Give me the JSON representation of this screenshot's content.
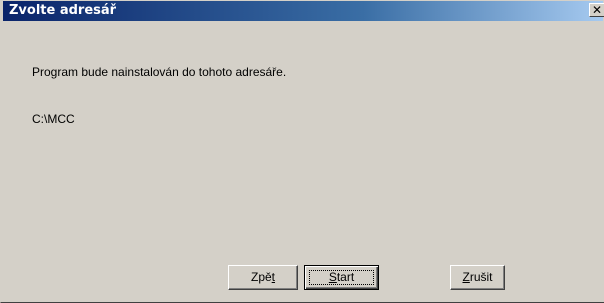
{
  "window": {
    "title": "Zvolte adresář"
  },
  "main": {
    "message": "Program bude nainstalován do tohoto adresáře.",
    "path": "C:\\MCC"
  },
  "buttons": {
    "back": {
      "pre": "Zpě",
      "accel": "t",
      "post": ""
    },
    "start": {
      "pre": "",
      "accel": "S",
      "post": "tart"
    },
    "cancel": {
      "pre": "",
      "accel": "Z",
      "post": "rušit"
    }
  },
  "icons": {
    "close": "close-icon"
  },
  "colors": {
    "titlebar_start": "#0a246a",
    "titlebar_end": "#a6caf0",
    "face": "#d4d0c8"
  }
}
